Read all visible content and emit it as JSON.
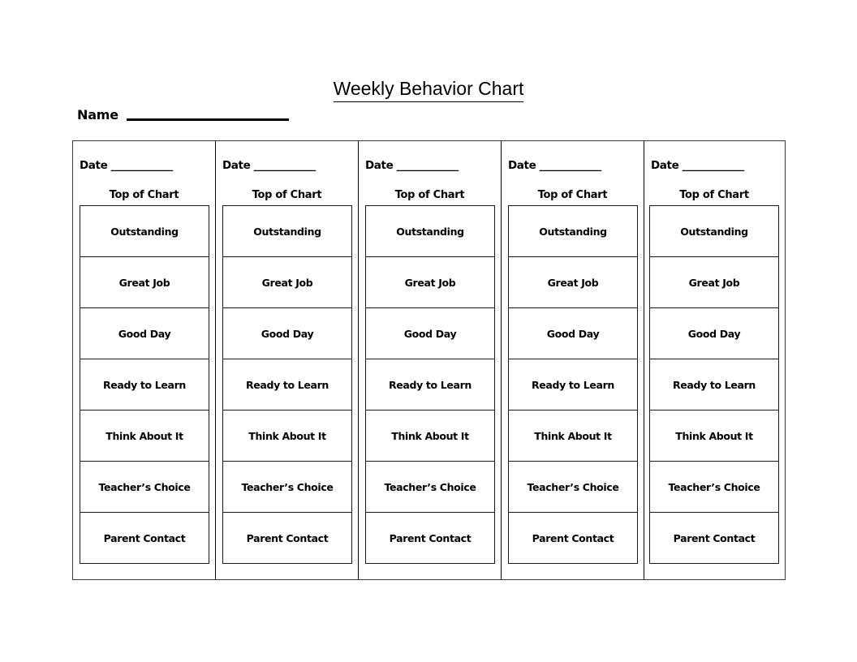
{
  "document": {
    "title": "Weekly Behavior Chart",
    "name_label": "Name",
    "name_value": ""
  },
  "chart": {
    "date_label": "Date ____________",
    "top_of_chart_label": "Top of Chart",
    "levels": [
      "Outstanding",
      "Great Job",
      "Good Day",
      "Ready to Learn",
      "Think About It",
      "Teacher’s Choice",
      "Parent Contact"
    ],
    "columns": [
      {
        "index": 1,
        "date_label": "Date ____________",
        "top_of_chart_label": "Top of Chart"
      },
      {
        "index": 2,
        "date_label": "Date ____________",
        "top_of_chart_label": "Top of Chart"
      },
      {
        "index": 3,
        "date_label": "Date ____________",
        "top_of_chart_label": "Top of Chart"
      },
      {
        "index": 4,
        "date_label": "Date ____________",
        "top_of_chart_label": "Top of Chart"
      },
      {
        "index": 5,
        "date_label": "Date ____________",
        "top_of_chart_label": "Top of Chart"
      }
    ]
  },
  "colors": {
    "ink": "#000000",
    "frame": "#3a3a3a",
    "cell_border": "#1a1a1a",
    "page": "#ffffff"
  }
}
